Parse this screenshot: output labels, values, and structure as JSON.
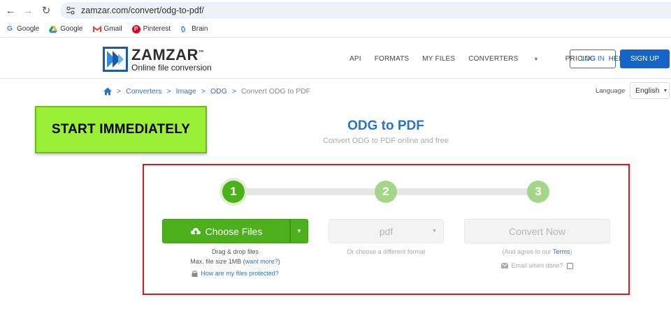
{
  "browser": {
    "url": "zamzar.com/convert/odg-to-pdf/",
    "bookmarks": [
      {
        "label": "Google",
        "icon": "google-g-icon"
      },
      {
        "label": "Google",
        "icon": "google-drive-icon"
      },
      {
        "label": "Gmail",
        "icon": "gmail-icon"
      },
      {
        "label": "Pinterest",
        "icon": "pinterest-icon"
      },
      {
        "label": "Brain",
        "icon": "brain-icon"
      }
    ]
  },
  "header": {
    "brand": "ZAMZAR",
    "brand_mark": "™",
    "tagline": "Online file conversion",
    "menu": [
      "API",
      "FORMATS",
      "MY FILES",
      "CONVERTERS",
      "PRICING",
      "HELP"
    ],
    "login": "LOG IN",
    "signup": "SIGN UP"
  },
  "breadcrumb": {
    "sep": ">",
    "items": [
      "Converters",
      "Image",
      "ODG"
    ],
    "current": "Convert ODG to PDF"
  },
  "language": {
    "label": "Language",
    "value": "English"
  },
  "badge": "START IMMEDIATELY",
  "main": {
    "title": "ODG to PDF",
    "subtitle": "Convert ODG to PDF online and free"
  },
  "steps": [
    "1",
    "2",
    "3"
  ],
  "upload": {
    "button": "Choose Files",
    "drag": "Drag & drop files",
    "max_prefix": "Max. file size 1MB (",
    "max_link": "want more?",
    "max_suffix": ")",
    "protected": "How are my files protected?"
  },
  "format": {
    "value": "pdf",
    "hint": "Or choose a different format"
  },
  "convert": {
    "button": "Convert Now",
    "terms_prefix": "(And agree to our ",
    "terms_link": "Terms",
    "terms_suffix": ")",
    "email": "Email when done?"
  },
  "colors": {
    "accent_blue": "#2b73c9",
    "green": "#4caf1c",
    "badge_green": "#9bf037",
    "highlight_red": "#e5141e"
  }
}
